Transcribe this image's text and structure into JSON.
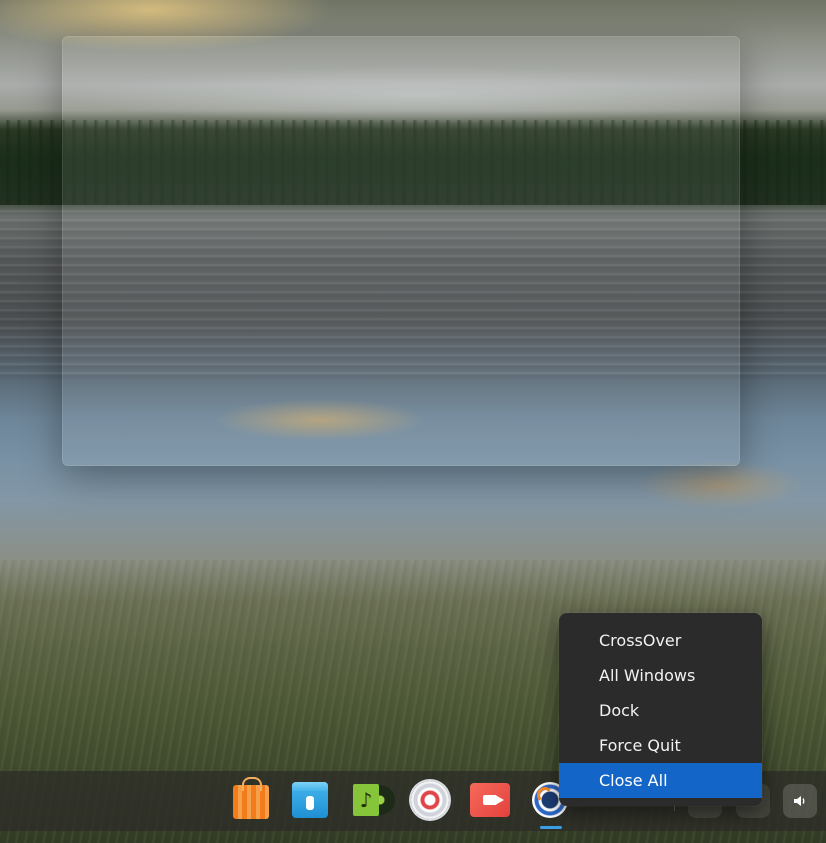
{
  "context_menu": {
    "items": [
      {
        "label": "CrossOver",
        "highlighted": false
      },
      {
        "label": "All Windows",
        "highlighted": false
      },
      {
        "label": "Dock",
        "highlighted": false
      },
      {
        "label": "Force Quit",
        "highlighted": false
      },
      {
        "label": "Close All",
        "highlighted": true
      }
    ],
    "highlight_color": "#1366c7"
  },
  "dock": {
    "apps": [
      {
        "icon": "app-store-icon"
      },
      {
        "icon": "archive-manager-icon"
      },
      {
        "icon": "music-player-icon"
      },
      {
        "icon": "settings-icon"
      },
      {
        "icon": "screen-recorder-icon"
      },
      {
        "icon": "crossover-icon",
        "active": true
      }
    ],
    "tray": [
      {
        "icon": "tray-icon"
      },
      {
        "icon": "tray-icon"
      },
      {
        "icon": "volume-icon"
      }
    ],
    "active_indicator_color": "#3a9fe6"
  }
}
